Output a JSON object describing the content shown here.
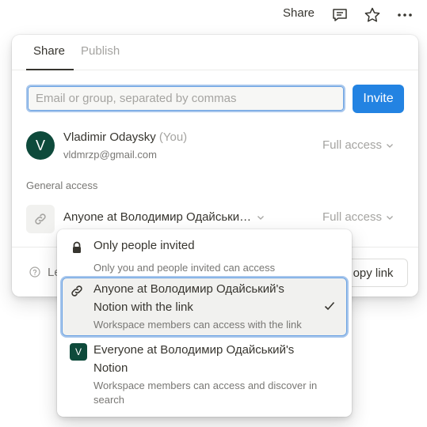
{
  "topbar": {
    "share_label": "Share",
    "icons": [
      "comment-icon",
      "star-icon",
      "more-icon"
    ]
  },
  "tabs": [
    {
      "label": "Share",
      "active": true
    },
    {
      "label": "Publish",
      "active": false
    }
  ],
  "invite": {
    "placeholder": "Email or group, separated by commas",
    "value": "",
    "button_label": "Invite"
  },
  "user": {
    "avatar_letter": "V",
    "name": "Vladimir Odaysky",
    "you_tag": "(You)",
    "email": "vldmrzp@gmail.com",
    "access": "Full access"
  },
  "general_access": {
    "label": "General access",
    "selected": "Anyone at Володимир Одайськи…",
    "access": "Full access"
  },
  "footer": {
    "learn_text": "Le",
    "copy_label": "opy link"
  },
  "dropdown": {
    "options": [
      {
        "title": "Only people invited",
        "description": "Only you and people invited can access",
        "icon": "lock-icon",
        "selected": false
      },
      {
        "title": "Anyone at Володимир Одайський's Notion with the link",
        "description": "Workspace members can access with the link",
        "icon": "link-icon",
        "selected": true
      },
      {
        "title": "Everyone at Володимир Одайський's Notion",
        "description": "Workspace members can access and discover in search",
        "icon": "workspace-icon",
        "icon_letter": "V",
        "selected": false
      }
    ]
  },
  "colors": {
    "accent": "#2383e2",
    "avatar_bg": "#0e4a3b",
    "focus_ring": "#a7c6ec",
    "text": "#37352f",
    "muted": "#a5a4a1"
  }
}
